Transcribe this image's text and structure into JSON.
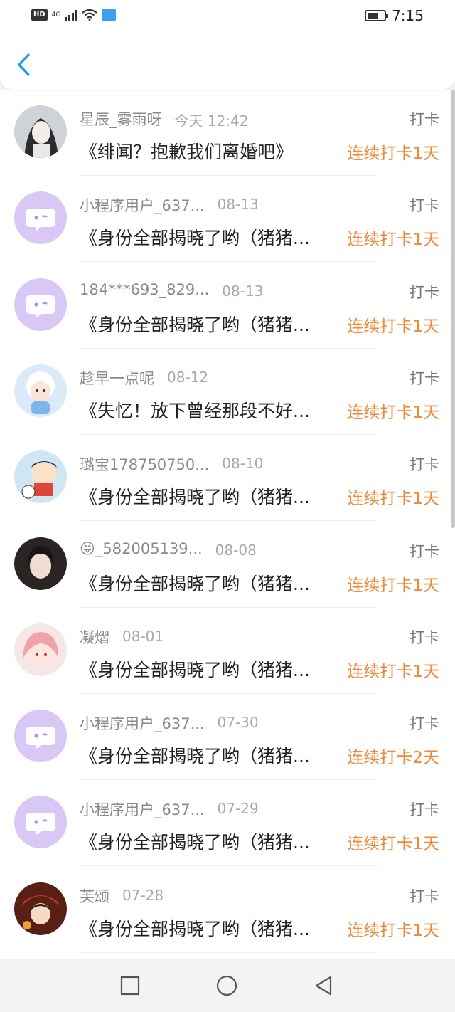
{
  "status_bar": {
    "hd": "HD",
    "network": "4G",
    "time": "7:15"
  },
  "header": {
    "back_icon": "chevron-left-icon"
  },
  "colors": {
    "streak": "#f0883a",
    "back": "#1a9af0",
    "bot_avatar": "#d9c8f5",
    "bot_icon": "#b18ef0"
  },
  "entries": [
    {
      "name": "星辰_雾雨呀",
      "date": "今天 12:42",
      "tag": "打卡",
      "title": "《绯闻？抱歉我们离婚吧》",
      "streak": "连续打卡1天",
      "avatar": "photo-girl-sketch"
    },
    {
      "name": "小程序用户_637...",
      "date": "08-13",
      "tag": "打卡",
      "title": "《身份全部揭晓了哟（猪猪...",
      "streak": "连续打卡1天",
      "avatar": "bot-face"
    },
    {
      "name": "184***693_829...",
      "date": "08-13",
      "tag": "打卡",
      "title": "《身份全部揭晓了哟（猪猪...",
      "streak": "连续打卡1天",
      "avatar": "bot-face"
    },
    {
      "name": "趁早一点呢",
      "date": "08-12",
      "tag": "打卡",
      "title": "《失忆！放下曾经那段不好...",
      "streak": "连续打卡1天",
      "avatar": "cartoon-sheep"
    },
    {
      "name": "璐宝178750750...",
      "date": "08-10",
      "tag": "打卡",
      "title": "《身份全部揭晓了哟（猪猪...",
      "streak": "连续打卡1天",
      "avatar": "cartoon-boy"
    },
    {
      "name": "😝_582005139...",
      "date": "08-08",
      "tag": "打卡",
      "title": "《身份全部揭晓了哟（猪猪...",
      "streak": "连续打卡1天",
      "avatar": "photo-girl"
    },
    {
      "name": "凝熠",
      "date": "08-01",
      "tag": "打卡",
      "title": "《身份全部揭晓了哟（猪猪...",
      "streak": "连续打卡1天",
      "avatar": "anime-pink"
    },
    {
      "name": "小程序用户_637...",
      "date": "07-30",
      "tag": "打卡",
      "title": "《身份全部揭晓了哟（猪猪...",
      "streak": "连续打卡2天",
      "avatar": "bot-face"
    },
    {
      "name": "小程序用户_637...",
      "date": "07-29",
      "tag": "打卡",
      "title": "《身份全部揭晓了哟（猪猪...",
      "streak": "连续打卡1天",
      "avatar": "bot-face"
    },
    {
      "name": "芙颂",
      "date": "07-28",
      "tag": "打卡",
      "title": "《身份全部揭晓了哟（猪猪...",
      "streak": "连续打卡1天",
      "avatar": "anime-red"
    }
  ],
  "nav_bar": {
    "recents": "square-icon",
    "home": "circle-icon",
    "back": "triangle-back-icon"
  }
}
